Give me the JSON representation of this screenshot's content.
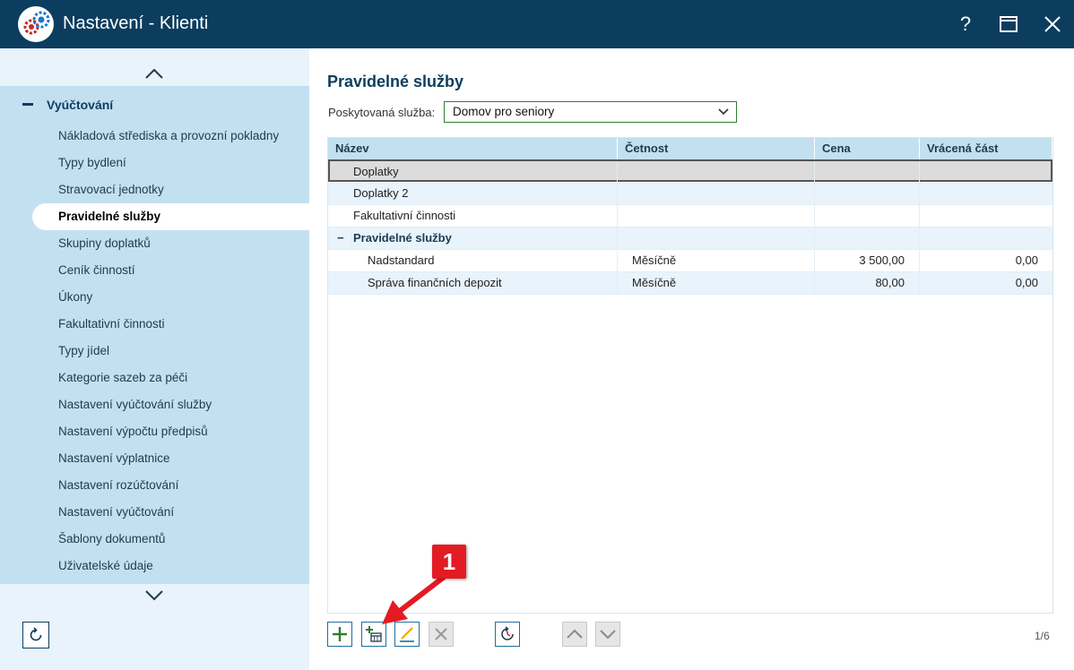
{
  "window": {
    "title": "Nastavení - Klienti",
    "help_label": "?"
  },
  "sidebar": {
    "group": {
      "label": "Vyúčtování",
      "expanded": true
    },
    "items": [
      {
        "label": "Nákladová střediska a provozní pokladny",
        "active": false
      },
      {
        "label": "Typy bydlení",
        "active": false
      },
      {
        "label": "Stravovací jednotky",
        "active": false
      },
      {
        "label": "Pravidelné služby",
        "active": true
      },
      {
        "label": "Skupiny doplatků",
        "active": false
      },
      {
        "label": "Ceník činností",
        "active": false
      },
      {
        "label": "Úkony",
        "active": false
      },
      {
        "label": "Fakultativní činnosti",
        "active": false
      },
      {
        "label": "Typy jídel",
        "active": false
      },
      {
        "label": "Kategorie sazeb za péči",
        "active": false
      },
      {
        "label": "Nastavení vyúčtování služby",
        "active": false
      },
      {
        "label": "Nastavení výpočtu předpisů",
        "active": false
      },
      {
        "label": "Nastavení výplatnice",
        "active": false
      },
      {
        "label": "Nastavení rozúčtování",
        "active": false
      },
      {
        "label": "Nastavení vyúčtování",
        "active": false
      },
      {
        "label": "Šablony dokumentů",
        "active": false
      },
      {
        "label": "Uživatelské údaje",
        "active": false
      }
    ]
  },
  "main": {
    "title": "Pravidelné služby",
    "service_label": "Poskytovaná služba:",
    "service_value": "Domov pro seniory",
    "grid": {
      "columns": [
        "Název",
        "Četnost",
        "Cena",
        "Vrácená část"
      ],
      "rows": [
        {
          "name": "Doplatky",
          "frequency": "",
          "price": "",
          "refund": "",
          "selected": true
        },
        {
          "name": "Doplatky 2",
          "frequency": "",
          "price": "",
          "refund": ""
        },
        {
          "name": "Fakultativní činnosti",
          "frequency": "",
          "price": "",
          "refund": ""
        },
        {
          "name": "Pravidelné služby",
          "frequency": "",
          "price": "",
          "refund": "",
          "group": true,
          "group_toggle": "−"
        },
        {
          "name": "Nadstandard",
          "frequency": "Měsíčně",
          "price": "3 500,00",
          "refund": "0,00"
        },
        {
          "name": "Správa finančních depozit",
          "frequency": "Měsíčně",
          "price": "80,00",
          "refund": "0,00"
        }
      ]
    },
    "pager": "1/6"
  },
  "annotation": {
    "badge": "1"
  },
  "colors": {
    "titlebar": "#0c3d5e",
    "sidebar": "#c3e0f1",
    "accent": "#1f6f9f",
    "annotation": "#e31b23"
  },
  "icons": {
    "toolbar": [
      "add-icon",
      "add-schedule-icon",
      "edit-icon",
      "delete-icon",
      "history-icon",
      "move-up-icon",
      "move-down-icon"
    ]
  }
}
